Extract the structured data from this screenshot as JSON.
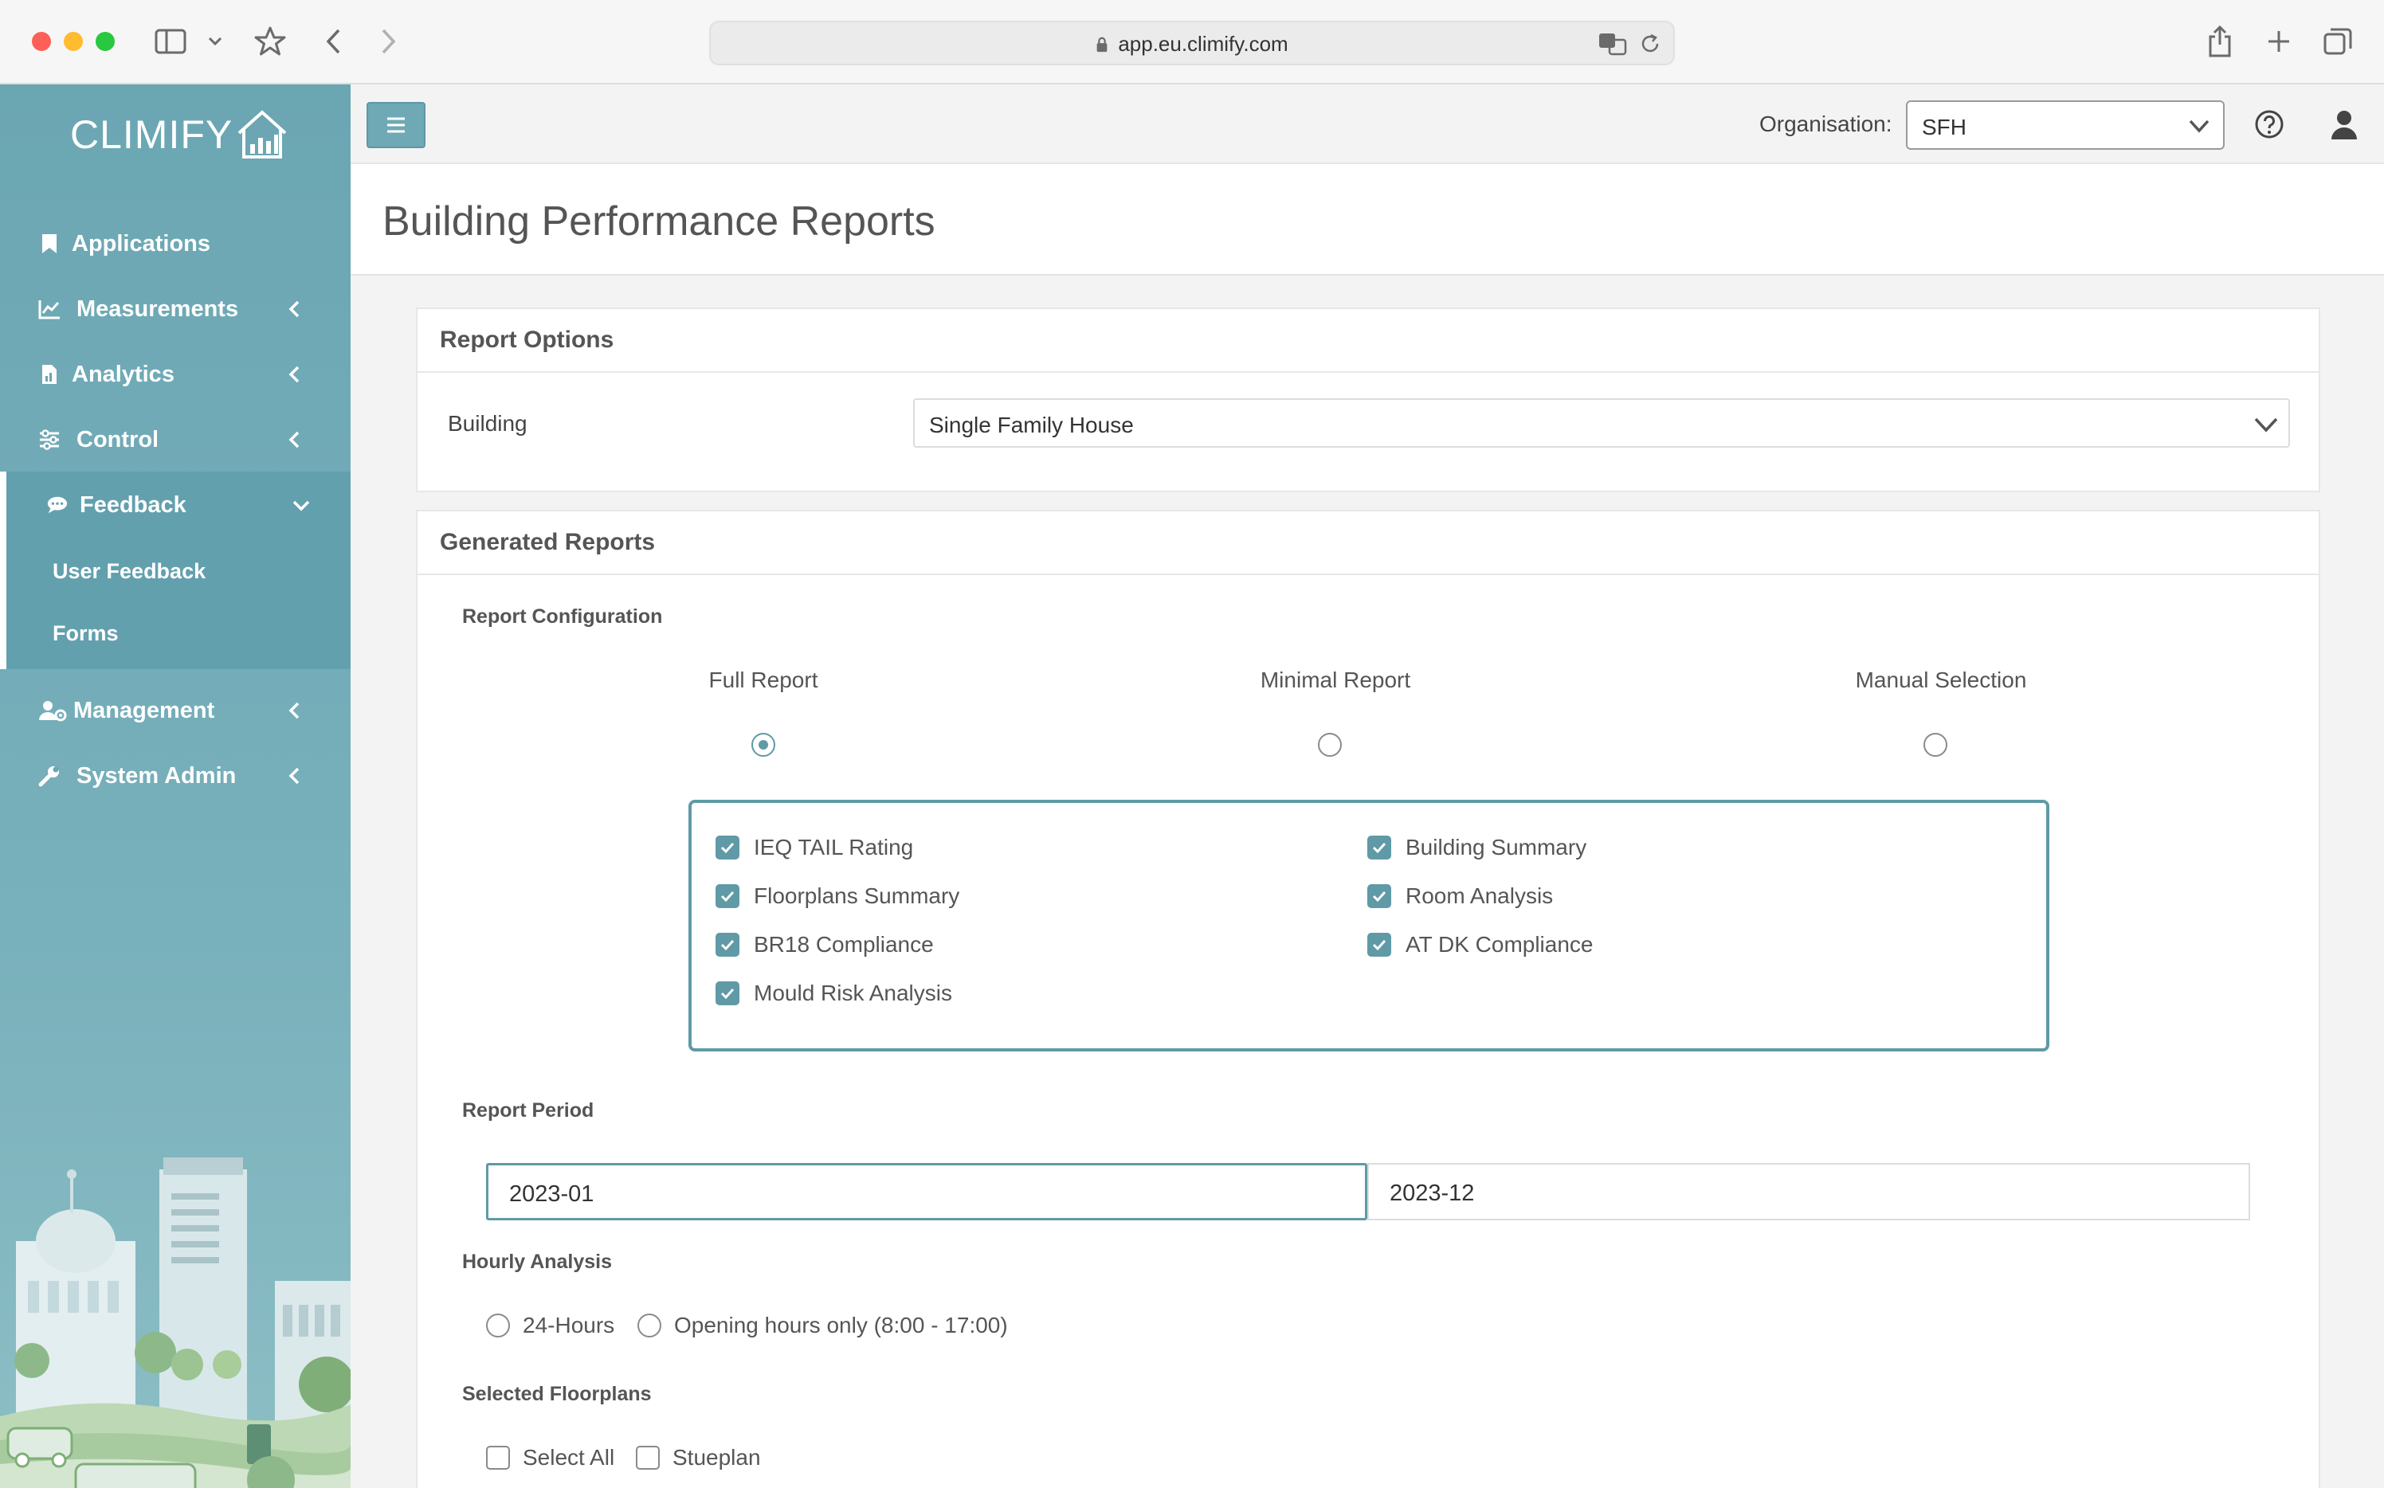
{
  "browser": {
    "url": "app.eu.climify.com"
  },
  "brand": {
    "logo_text": "CLIMIFY"
  },
  "sidebar": {
    "items": [
      {
        "label": "Applications",
        "icon": "bookmark-icon"
      },
      {
        "label": "Measurements",
        "icon": "line-chart-icon"
      },
      {
        "label": "Analytics",
        "icon": "file-chart-icon"
      },
      {
        "label": "Control",
        "icon": "sliders-icon"
      },
      {
        "label": "Feedback",
        "icon": "comment-icon"
      },
      {
        "label": "Management",
        "icon": "users-cog-icon"
      },
      {
        "label": "System Admin",
        "icon": "wrench-icon"
      }
    ],
    "feedback_sub": [
      "User Feedback",
      "Forms"
    ]
  },
  "topbar": {
    "org_label": "Organisation:",
    "org_value": "SFH"
  },
  "page": {
    "title": "Building Performance Reports"
  },
  "report_options": {
    "heading": "Report Options",
    "building_label": "Building",
    "building_value": "Single Family House"
  },
  "generated": {
    "heading": "Generated Reports",
    "config_label": "Report Configuration",
    "config_options": [
      "Full Report",
      "Minimal Report",
      "Manual Selection"
    ],
    "selected_config": "Full Report",
    "checks_left": [
      "IEQ TAIL Rating",
      "Floorplans Summary",
      "BR18 Compliance",
      "Mould Risk Analysis"
    ],
    "checks_right": [
      "Building Summary",
      "Room Analysis",
      "AT DK Compliance"
    ],
    "period_label": "Report Period",
    "period_start": "2023-01",
    "period_end": "2023-12",
    "hourly_label": "Hourly Analysis",
    "hourly_options": [
      "24-Hours",
      "Opening hours only (8:00 - 17:00)"
    ],
    "floorplans_label": "Selected Floorplans",
    "floorplan_options": [
      "Select All",
      "Stueplan"
    ]
  },
  "colors": {
    "accent": "#5f9aa6",
    "sidebar": "#6ba6b3"
  }
}
